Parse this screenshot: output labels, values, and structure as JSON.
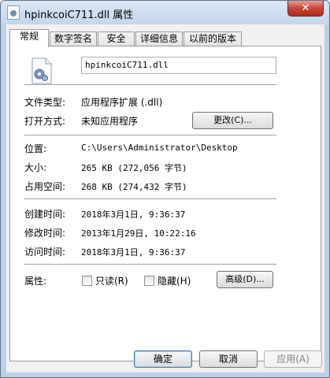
{
  "window": {
    "title": "hpinkcoiC711.dll 属性",
    "close_label": "✕"
  },
  "tabs": [
    {
      "label": "常规",
      "active": true
    },
    {
      "label": "数字签名",
      "active": false
    },
    {
      "label": "安全",
      "active": false
    },
    {
      "label": "详细信息",
      "active": false
    },
    {
      "label": "以前的版本",
      "active": false
    }
  ],
  "general": {
    "icon": "dll-file-icon",
    "file_name": "hpinkcoiC711.dll",
    "file_type_label": "文件类型:",
    "file_type_value": "应用程序扩展 (.dll)",
    "opens_with_label": "打开方式:",
    "opens_with_value": "未知应用程序",
    "change_button": "更改(C)...",
    "location_label": "位置:",
    "location_value": "C:\\Users\\Administrator\\Desktop",
    "size_label": "大小:",
    "size_value": "265 KB (272,056 字节)",
    "size_on_disk_label": "占用空间:",
    "size_on_disk_value": "268 KB (274,432 字节)",
    "created_label": "创建时间:",
    "created_value": "2018年3月1日, 9:36:37",
    "modified_label": "修改时间:",
    "modified_value": "2013年1月29日, 10:22:16",
    "accessed_label": "访问时间:",
    "accessed_value": "2018年3月1日, 9:36:37",
    "attributes_label": "属性:",
    "readonly_label": "只读(R)",
    "readonly_checked": false,
    "hidden_label": "隐藏(H)",
    "hidden_checked": false,
    "advanced_button": "高级(D)..."
  },
  "footer": {
    "ok": "确定",
    "cancel": "取消",
    "apply": "应用(A)"
  },
  "colors": {
    "frame": "#b9d1ea",
    "close_button": "#c7453a",
    "panel": "#ffffff"
  }
}
